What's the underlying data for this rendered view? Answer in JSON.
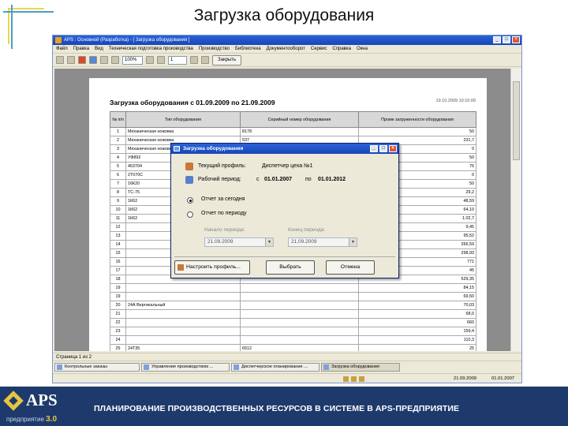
{
  "slide": {
    "title": "Загрузка оборудования",
    "footer_text": "ПЛАНИРОВАНИЕ ПРОИЗВОДСТВЕННЫХ РЕСУРСОВ В СИСТЕМЕ В APS-ПРЕДПРИЯТИЕ",
    "logo": {
      "text": "APS",
      "subtitle": "предприятие",
      "version": "3.0"
    }
  },
  "window": {
    "title": "APS : Основной (Разработка) - [ Загрузка оборудования ]",
    "menu": [
      "Файл",
      "Правка",
      "Вид",
      "Техническая подготовка производства",
      "Производство",
      "Библиотека",
      "Документооборот",
      "Сервис",
      "Справка",
      "Окна"
    ],
    "toolbar": {
      "zoom": "100%",
      "page_number": "1",
      "close_label": "Закрыть"
    }
  },
  "report": {
    "title": "Загрузка оборудования с 01.09.2009 по 21.09.2009",
    "date": "19.10.2009 10:10:09",
    "columns": [
      "№ п/п",
      "Тип оборудования",
      "Серийный номер оборудования",
      "Проме загруженности оборудования"
    ],
    "rows": [
      {
        "n": "1",
        "type": "Механическая ножовка",
        "serial": "8178",
        "value": "50"
      },
      {
        "n": "2",
        "type": "Механическая ножовка",
        "serial": "537",
        "value": "231,7"
      },
      {
        "n": "3",
        "type": "Механическая ножовка",
        "serial": "",
        "value": "0"
      },
      {
        "n": "4",
        "type": "УФ892",
        "serial": "",
        "value": "50"
      },
      {
        "n": "5",
        "type": "453704",
        "serial": "",
        "value": "75"
      },
      {
        "n": "6",
        "type": "2Т070С",
        "serial": "",
        "value": "0"
      },
      {
        "n": "7",
        "type": "16К20",
        "serial": "",
        "value": "50"
      },
      {
        "n": "8",
        "type": "ТС-75",
        "serial": "",
        "value": "29,2"
      },
      {
        "n": "9",
        "type": "1К62",
        "serial": "",
        "value": "48,59"
      },
      {
        "n": "10",
        "type": "1К62",
        "serial": "",
        "value": "64,10"
      },
      {
        "n": "11",
        "type": "1К62",
        "serial": "",
        "value": "1.02,7"
      },
      {
        "n": "12",
        "type": "",
        "serial": "",
        "value": "9,45"
      },
      {
        "n": "13",
        "type": "",
        "serial": "",
        "value": "95,52"
      },
      {
        "n": "14",
        "type": "",
        "serial": "",
        "value": "266,59"
      },
      {
        "n": "15",
        "type": "",
        "serial": "",
        "value": "298,93"
      },
      {
        "n": "16",
        "type": "",
        "serial": "",
        "value": "771"
      },
      {
        "n": "17",
        "type": "",
        "serial": "",
        "value": "45"
      },
      {
        "n": "18",
        "type": "",
        "serial": "",
        "value": "529,35"
      },
      {
        "n": "19",
        "type": "",
        "serial": "",
        "value": "84,15"
      },
      {
        "n": "19",
        "type": "",
        "serial": "",
        "value": "69,50"
      },
      {
        "n": "20",
        "type": "24А Вертикальный",
        "serial": "",
        "value": "70,03"
      },
      {
        "n": "21",
        "type": "",
        "serial": "",
        "value": "68,0"
      },
      {
        "n": "22",
        "type": "",
        "serial": "",
        "value": "660"
      },
      {
        "n": "23",
        "type": "",
        "serial": "",
        "value": "159,4"
      },
      {
        "n": "24",
        "type": "",
        "serial": "",
        "value": "110,3"
      },
      {
        "n": "25",
        "type": "24Т35",
        "serial": "6512",
        "value": "25"
      }
    ]
  },
  "dialog": {
    "title": "Загрузка оборудования",
    "profile_label": "Текущий профиль:",
    "profile_value": "Диспетчер цеха №1",
    "period_label": "Рабочий период:",
    "period_from_label": "с",
    "period_from": "01.01.2007",
    "period_to_label": "по",
    "period_to": "01.01.2012",
    "option_today": "Отчет за сегодня",
    "option_period": "Отчет по периоду",
    "start_label": "Начало периода:",
    "start_value": "21.09.2009",
    "end_label": "Конец периода:",
    "end_value": "21.09.2009",
    "btn_configure": "Настроить профиль...",
    "btn_select": "Выбрать",
    "btn_cancel": "Отмена"
  },
  "statusbar": {
    "text": "Страница 1 из 2"
  },
  "taskbar": {
    "items": [
      "Контрольные заказы",
      "Управление производством ...",
      "Диспетчерское планирование ...",
      "Загрузка оборудования"
    ]
  },
  "sysbar": {
    "time1": "21.09.2009",
    "time2": "01.01.2007"
  }
}
